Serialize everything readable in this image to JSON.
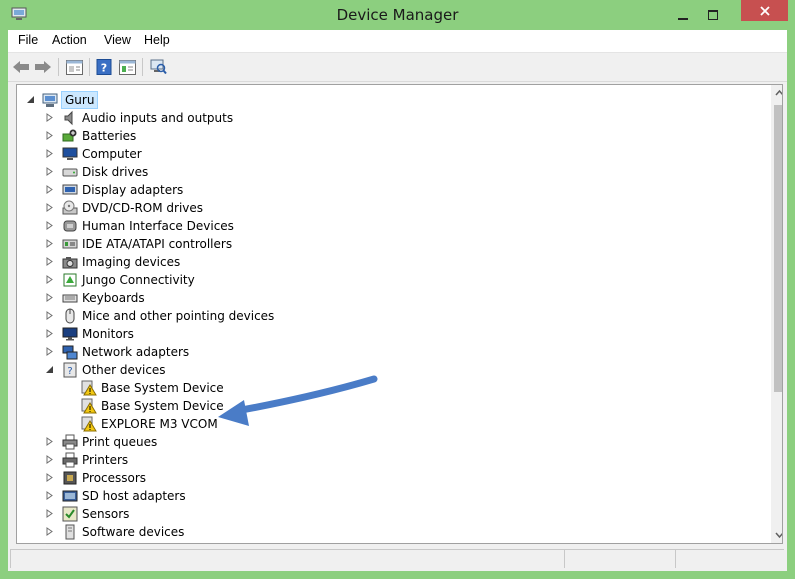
{
  "window": {
    "title": "Device Manager"
  },
  "menu": [
    "File",
    "Action",
    "View",
    "Help"
  ],
  "toolbar": [
    "back-icon",
    "forward-icon",
    "properties-icon",
    "help-icon",
    "details-icon",
    "scan-icon"
  ],
  "tree": {
    "root": "Guru",
    "categories": [
      {
        "label": "Audio inputs and outputs",
        "icon": "speaker-icon"
      },
      {
        "label": "Batteries",
        "icon": "battery-icon"
      },
      {
        "label": "Computer",
        "icon": "computer-icon"
      },
      {
        "label": "Disk drives",
        "icon": "disk-drive-icon"
      },
      {
        "label": "Display adapters",
        "icon": "display-adapter-icon"
      },
      {
        "label": "DVD/CD-ROM drives",
        "icon": "dvd-drive-icon"
      },
      {
        "label": "Human Interface Devices",
        "icon": "hid-icon"
      },
      {
        "label": "IDE ATA/ATAPI controllers",
        "icon": "ide-controller-icon"
      },
      {
        "label": "Imaging devices",
        "icon": "camera-icon"
      },
      {
        "label": "Jungo Connectivity",
        "icon": "jungo-icon"
      },
      {
        "label": "Keyboards",
        "icon": "keyboard-icon"
      },
      {
        "label": "Mice and other pointing devices",
        "icon": "mouse-icon"
      },
      {
        "label": "Monitors",
        "icon": "monitor-icon"
      },
      {
        "label": "Network adapters",
        "icon": "network-icon"
      },
      {
        "label": "Other devices",
        "icon": "unknown-device-icon",
        "expanded": true,
        "children": [
          {
            "label": "Base System Device",
            "icon": "warning-icon"
          },
          {
            "label": "Base System Device",
            "icon": "warning-icon"
          },
          {
            "label": "EXPLORE M3 VCOM",
            "icon": "warning-icon"
          }
        ]
      },
      {
        "label": "Print queues",
        "icon": "printer-icon"
      },
      {
        "label": "Printers",
        "icon": "printer-icon"
      },
      {
        "label": "Processors",
        "icon": "processor-icon"
      },
      {
        "label": "SD host adapters",
        "icon": "sd-card-icon"
      },
      {
        "label": "Sensors",
        "icon": "sensor-icon"
      },
      {
        "label": "Software devices",
        "icon": "software-device-icon"
      }
    ]
  },
  "colors": {
    "frame": "#8ccf7f",
    "close": "#c75050",
    "selection": "#cce8ff",
    "arrow": "#4a7cc7"
  }
}
